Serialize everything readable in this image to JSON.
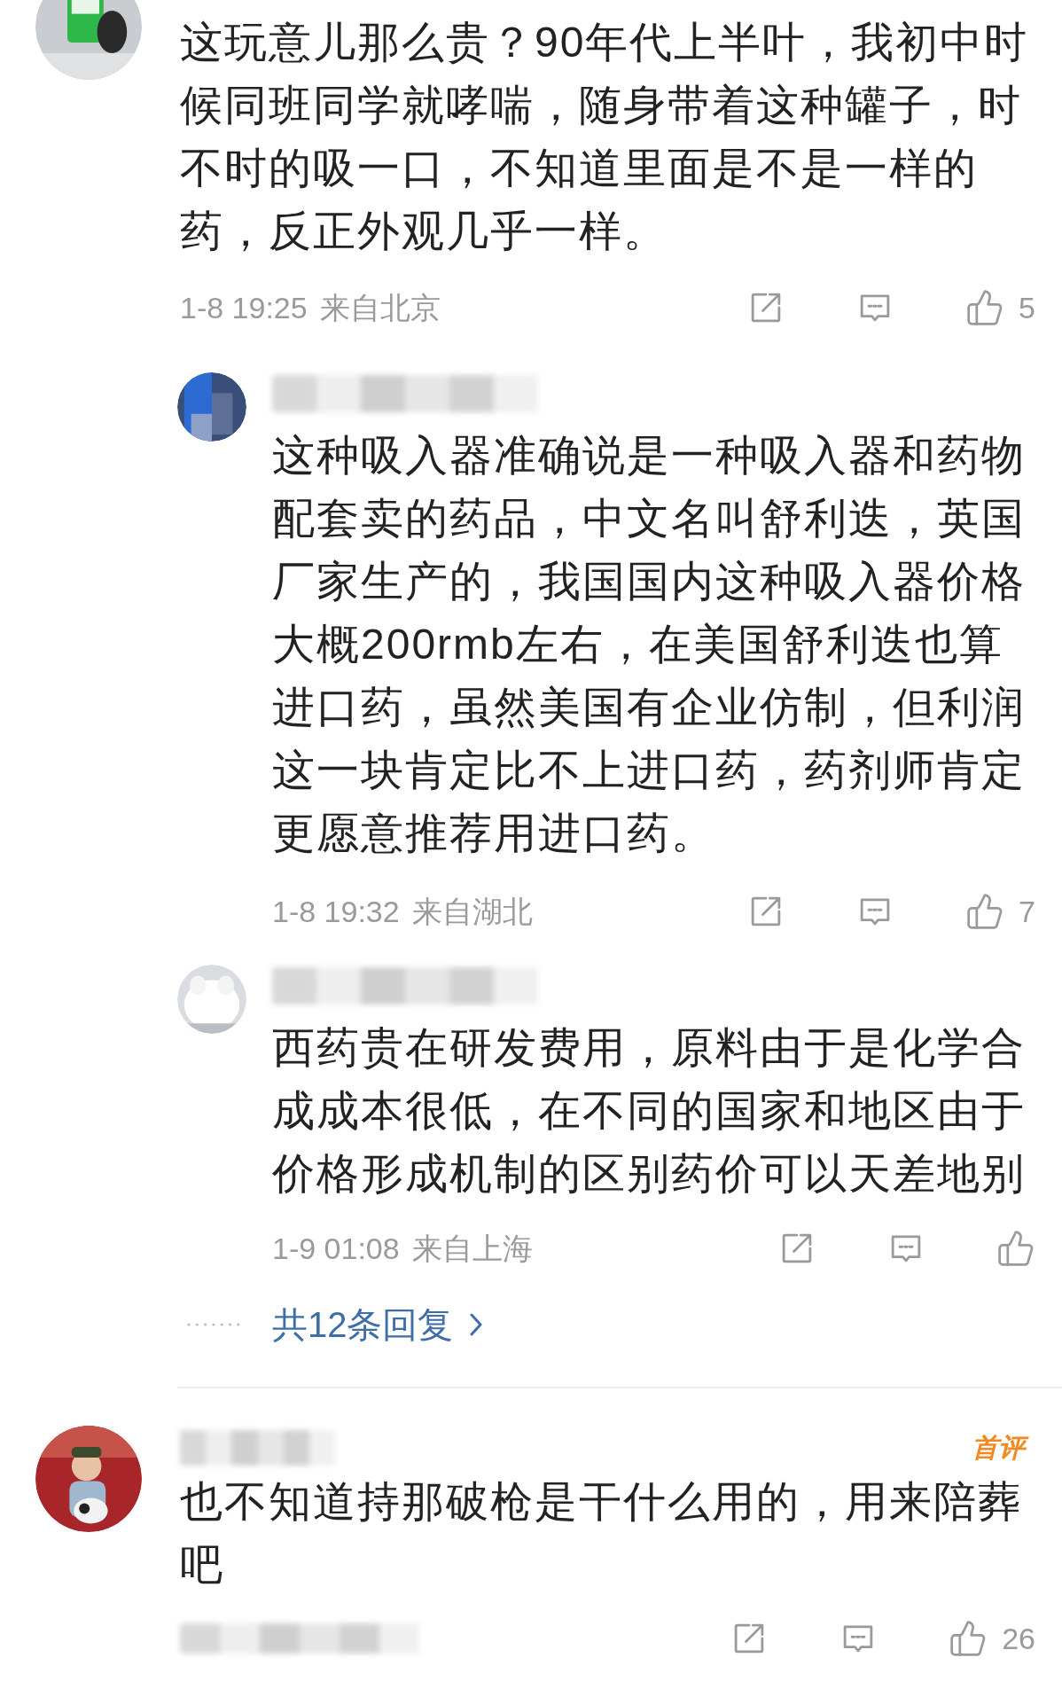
{
  "comments": [
    {
      "text": "这玩意儿那么贵？90年代上半叶，我初中时候同班同学就哮喘，随身带着这种罐子，时不时的吸一口，不知道里面是不是一样的药，反正外观几乎一样。",
      "time": "1-8 19:25",
      "location": "来自北京",
      "likes": "5",
      "replies": [
        {
          "name_blurred": true,
          "text": "这种吸入器准确说是一种吸入器和药物配套卖的药品，中文名叫舒利迭，英国厂家生产的，我国国内这种吸入器价格大概200rmb左右，在美国舒利迭也算进口药，虽然美国有企业仿制，但利润这一块肯定比不上进口药，药剂师肯定更愿意推荐用进口药。",
          "time": "1-8 19:32",
          "location": "来自湖北",
          "likes": "7"
        },
        {
          "name_blurred": true,
          "text": "西药贵在研发费用，原料由于是化学合成成本很低，在不同的国家和地区由于价格形成机制的区别药价可以天差地别",
          "time": "1-9 01:08",
          "location": "来自上海"
        }
      ],
      "more_replies": "共12条回复"
    },
    {
      "name_blurred": true,
      "badge": "首评",
      "text": "也不知道持那破枪是干什么用的，用来陪葬吧",
      "time_blurred": true,
      "likes": "26"
    }
  ]
}
